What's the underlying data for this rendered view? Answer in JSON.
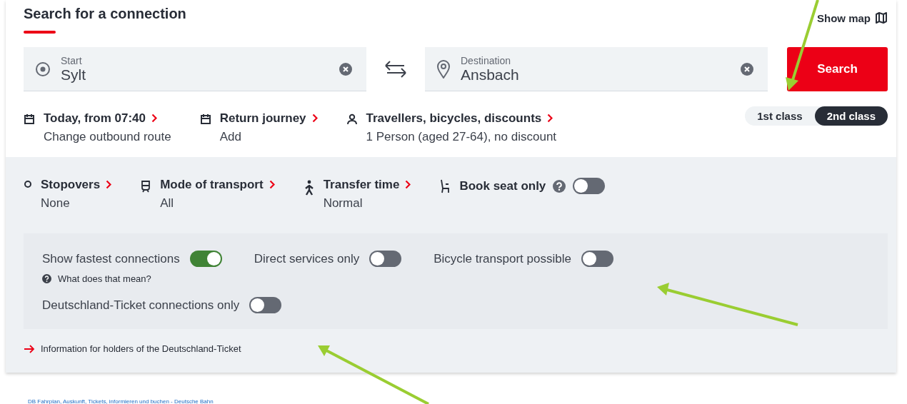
{
  "header": {
    "title": "Search for a connection",
    "show_map": "Show map"
  },
  "start": {
    "label": "Start",
    "value": "Sylt"
  },
  "destination": {
    "label": "Destination",
    "value": "Ansbach"
  },
  "search_button": "Search",
  "options": [
    {
      "kind": "calendar",
      "title": "Today, from 07:40",
      "sub": "Change outbound route"
    },
    {
      "kind": "calendar",
      "title": "Return journey",
      "sub": "Add"
    },
    {
      "kind": "person",
      "title": "Travellers, bicycles, discounts",
      "sub": "1 Person (aged 27-64), no discount"
    }
  ],
  "classes": [
    {
      "label": "1st class",
      "selected": false
    },
    {
      "label": "2nd class",
      "selected": true
    }
  ],
  "settings": [
    {
      "kind": "stopover",
      "title": "Stopovers",
      "sub": "None"
    },
    {
      "kind": "transport",
      "title": "Mode of transport",
      "sub": "All"
    },
    {
      "kind": "walk",
      "title": "Transfer time",
      "sub": "Normal"
    }
  ],
  "book_seat": {
    "label": "Book seat only",
    "on": false
  },
  "filters": [
    {
      "label": "Show fastest connections",
      "on": true,
      "help": "What does that mean?"
    },
    {
      "label": "Direct services only",
      "on": false
    },
    {
      "label": "Bicycle transport possible",
      "on": false
    },
    {
      "label": "Deutschland-Ticket connections only",
      "on": false
    }
  ],
  "info_link": "Information for holders of the Deutschland-Ticket",
  "footer": "DB Fahrplan, Auskunft, Tickets, informieren und buchen - Deutsche Bahn"
}
